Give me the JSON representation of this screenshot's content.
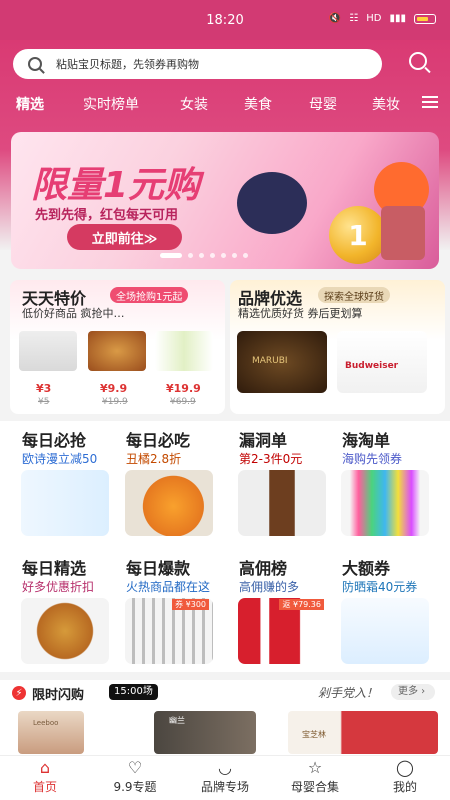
{
  "status": {
    "time": "18:20",
    "network": "HD"
  },
  "search": {
    "placeholder": "粘贴宝贝标题，先领券再购物"
  },
  "nav": {
    "tabs": [
      "精选",
      "实时榜单",
      "女装",
      "美食",
      "母婴",
      "美妆"
    ]
  },
  "banner": {
    "title": "限量1元购",
    "subtitle": "先到先得，红包每天可用",
    "button": "立即前往≫",
    "coin": "1"
  },
  "promo": {
    "left": {
      "title": "天天特价",
      "badge": "全场抢购1元起",
      "desc": "低价好商品 疯抢中…",
      "products": [
        {
          "price": "¥3",
          "old": "¥5"
        },
        {
          "price": "¥9.9",
          "old": "¥19.9"
        },
        {
          "price": "¥19.9",
          "old": "¥69.9"
        }
      ]
    },
    "right": {
      "title": "品牌优选",
      "badge": "探索全球好货",
      "desc": "精选优质好货 券后更划算",
      "brands": [
        "MARUBI",
        "Budweiser"
      ]
    }
  },
  "categories": [
    {
      "title": "每日必抢",
      "subtitle": "欧诗漫立减50",
      "color": "#2f6ed4"
    },
    {
      "title": "每日必吃",
      "subtitle": "丑橘2.8折",
      "color": "#c34a00"
    },
    {
      "title": "漏洞单",
      "subtitle": "第2-3件0元",
      "color": "#c10000"
    },
    {
      "title": "海淘单",
      "subtitle": "海购先领券",
      "color": "#4b59c9"
    },
    {
      "title": "每日精选",
      "subtitle": "好多优惠折扣",
      "color": "#b7306c"
    },
    {
      "title": "每日爆款",
      "subtitle": "火热商品都在这",
      "color": "#2269c4"
    },
    {
      "title": "高佣榜",
      "subtitle": "高佣赚的多",
      "color": "#3a61a8"
    },
    {
      "title": "大额券",
      "subtitle": "防晒霜40元券",
      "color": "#1d75b8"
    }
  ],
  "coupons": {
    "exploding": "券 ¥300",
    "high_commission": "返 ¥79.36"
  },
  "flash": {
    "title": "限时闪购",
    "time": "15:00场",
    "hurry": "剁手党入！",
    "more": "更多 ›"
  },
  "tiles": [
    "Leeboo",
    "幽兰",
    "宝芝林"
  ],
  "tabbar": [
    {
      "label": "首页",
      "icon": "home-icon"
    },
    {
      "label": "9.9专题",
      "icon": "heart-icon"
    },
    {
      "label": "品牌专场",
      "icon": "brand-icon"
    },
    {
      "label": "母婴合集",
      "icon": "star-icon"
    },
    {
      "label": "我的",
      "icon": "chat-icon"
    }
  ]
}
